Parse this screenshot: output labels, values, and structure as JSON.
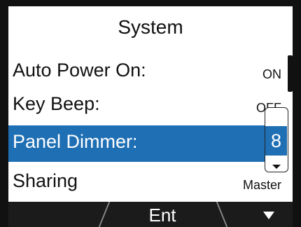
{
  "header": {
    "title": "System"
  },
  "settings": [
    {
      "label": "Auto Power On:",
      "value": "ON"
    },
    {
      "label": "Key Beep:",
      "value": "OFF"
    },
    {
      "label": "Panel Dimmer:",
      "value": "8"
    },
    {
      "label": "Sharing",
      "value": "Master"
    }
  ],
  "selected_index": 2,
  "softkeys": {
    "left": "",
    "center": "Ent",
    "right_icon": "down-triangle-icon"
  },
  "colors": {
    "selection": "#1f6fb4",
    "background": "#ffffff",
    "softbar": "#1b1b1b"
  }
}
